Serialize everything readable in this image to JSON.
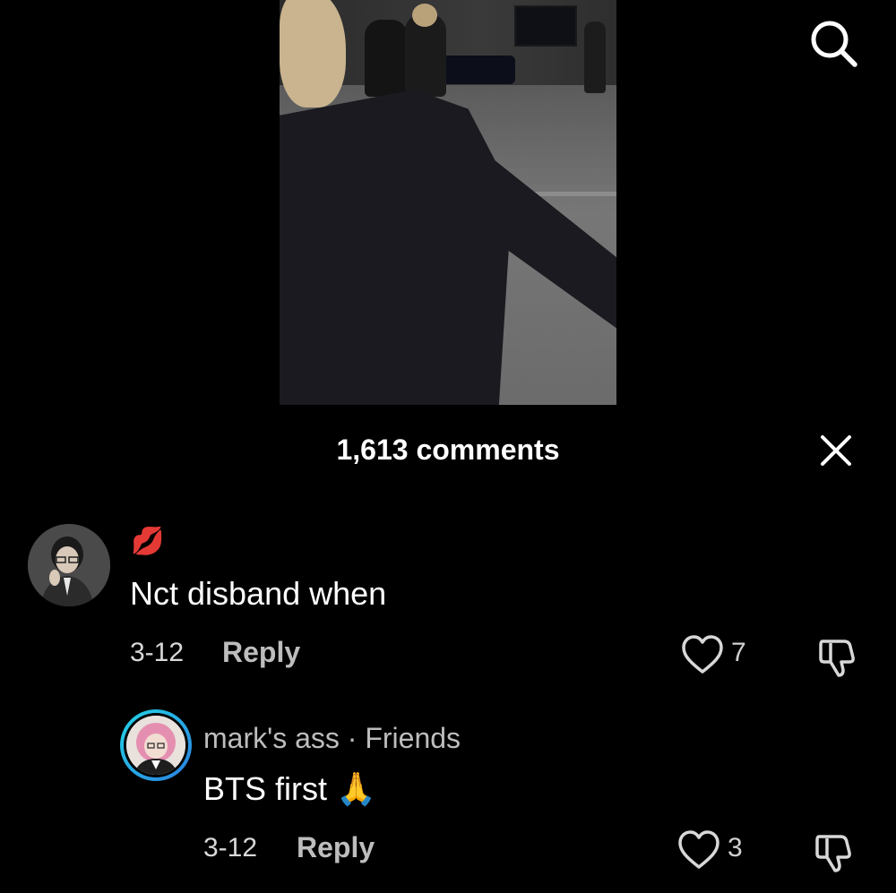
{
  "header": {
    "comments_count": "1,613 comments"
  },
  "icons": {
    "search": "search-icon",
    "close": "close-icon",
    "like": "heart-icon",
    "dislike": "thumbs-down-icon"
  },
  "comments": [
    {
      "badge": "💋",
      "text": "Nct disband when",
      "date": "3-12",
      "reply_label": "Reply",
      "likes": "7"
    },
    {
      "username": "mark's ass",
      "relation": "Friends",
      "separator": " · ",
      "text": "BTS first 🙏",
      "date": "3-12",
      "reply_label": "Reply",
      "likes": "3"
    }
  ],
  "colors": {
    "background": "#000000",
    "ring_gradient_start": "#23d5e6",
    "ring_gradient_end": "#2b7fe0"
  }
}
